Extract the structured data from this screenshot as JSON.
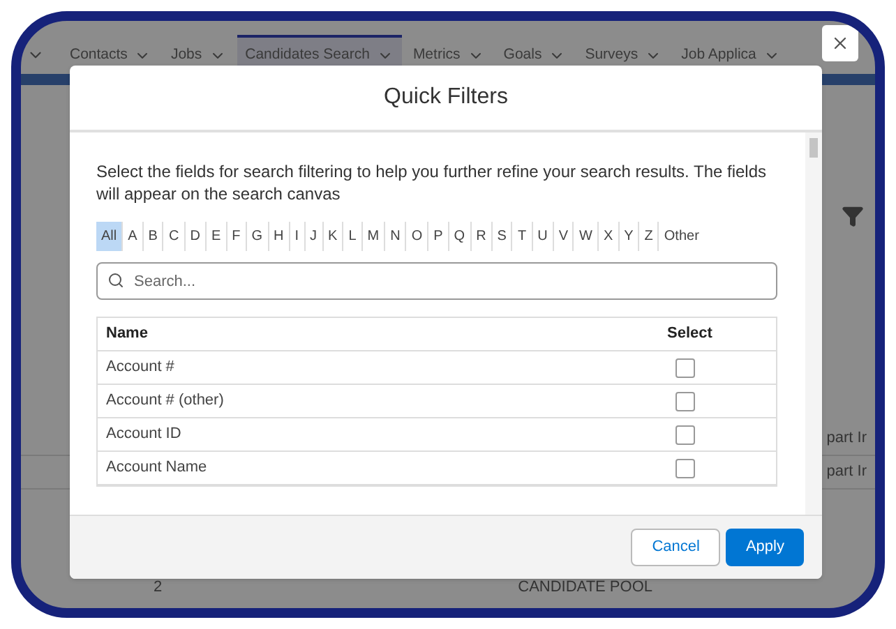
{
  "nav_tabs": [
    {
      "label": "Contacts",
      "selected": false
    },
    {
      "label": "Jobs",
      "selected": false
    },
    {
      "label": "Candidates Search",
      "selected": true
    },
    {
      "label": "Metrics",
      "selected": false
    },
    {
      "label": "Goals",
      "selected": false
    },
    {
      "label": "Surveys",
      "selected": false
    },
    {
      "label": "Job Applica",
      "selected": false
    }
  ],
  "background_rows": [
    {
      "text": "part Ir"
    },
    {
      "text": "part Ir"
    }
  ],
  "background_footer": {
    "number": "2",
    "label": "CANDIDATE POOL"
  },
  "modal": {
    "title": "Quick Filters",
    "instructions": "Select the fields for search filtering to help you further refine your search results. The fields will appear on the search canvas",
    "letters": [
      {
        "label": "All",
        "selected": true
      },
      {
        "label": "A",
        "selected": false
      },
      {
        "label": "B",
        "selected": false
      },
      {
        "label": "C",
        "selected": false
      },
      {
        "label": "D",
        "selected": false
      },
      {
        "label": "E",
        "selected": false
      },
      {
        "label": "F",
        "selected": false
      },
      {
        "label": "G",
        "selected": false
      },
      {
        "label": "H",
        "selected": false
      },
      {
        "label": "I",
        "selected": false
      },
      {
        "label": "J",
        "selected": false
      },
      {
        "label": "K",
        "selected": false
      },
      {
        "label": "L",
        "selected": false
      },
      {
        "label": "M",
        "selected": false
      },
      {
        "label": "N",
        "selected": false
      },
      {
        "label": "O",
        "selected": false
      },
      {
        "label": "P",
        "selected": false
      },
      {
        "label": "Q",
        "selected": false
      },
      {
        "label": "R",
        "selected": false
      },
      {
        "label": "S",
        "selected": false
      },
      {
        "label": "T",
        "selected": false
      },
      {
        "label": "U",
        "selected": false
      },
      {
        "label": "V",
        "selected": false
      },
      {
        "label": "W",
        "selected": false
      },
      {
        "label": "X",
        "selected": false
      },
      {
        "label": "Y",
        "selected": false
      },
      {
        "label": "Z",
        "selected": false
      },
      {
        "label": "Other",
        "selected": false
      }
    ],
    "search": {
      "placeholder": "Search..."
    },
    "table": {
      "columns": [
        "Name",
        "Select"
      ],
      "rows": [
        {
          "name": "Account #",
          "checked": false
        },
        {
          "name": "Account # (other)",
          "checked": false
        },
        {
          "name": "Account ID",
          "checked": false
        },
        {
          "name": "Account Name",
          "checked": false
        }
      ]
    },
    "buttons": {
      "cancel": "Cancel",
      "apply": "Apply"
    }
  }
}
